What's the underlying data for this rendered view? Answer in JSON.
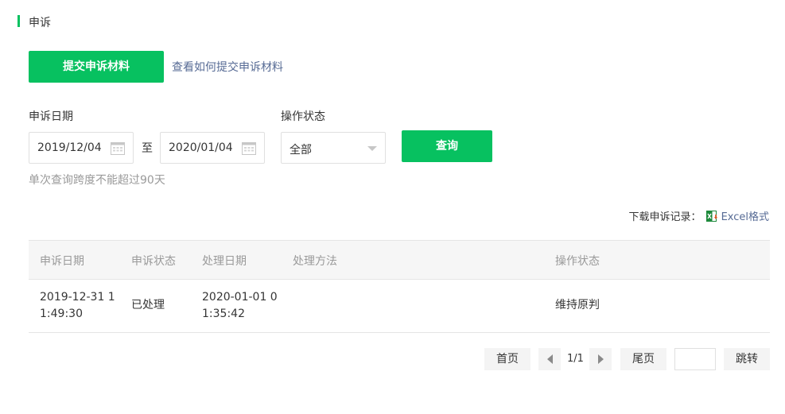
{
  "section": {
    "title": "申诉"
  },
  "actions": {
    "submit_label": "提交申诉材料",
    "help_link": "查看如何提交申诉材料"
  },
  "filters": {
    "date_label": "申诉日期",
    "start_date": "2019/12/04",
    "to_separator": "至",
    "end_date": "2020/01/04",
    "status_label": "操作状态",
    "status_selected": "全部",
    "query_label": "查询",
    "hint": "单次查询跨度不能超过90天"
  },
  "download": {
    "label": "下载申诉记录：",
    "format_link": "Excel格式"
  },
  "table": {
    "headers": [
      "申诉日期",
      "申诉状态",
      "处理日期",
      "处理方法",
      "操作状态"
    ],
    "rows": [
      {
        "appeal_date_line1": "2019-12-31 1",
        "appeal_date_line2": "1:49:30",
        "appeal_status": "已处理",
        "process_date_line1": "2020-01-01 0",
        "process_date_line2": "1:35:42",
        "method": "",
        "op_status": "维持原判"
      }
    ]
  },
  "pagination": {
    "first_label": "首页",
    "page_indicator": "1/1",
    "last_label": "尾页",
    "jump_value": "",
    "jump_label": "跳转"
  },
  "colors": {
    "accent": "#07c160",
    "link": "#576b95"
  }
}
